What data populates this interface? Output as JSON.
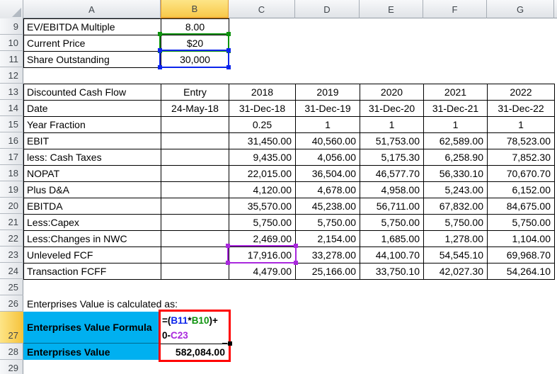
{
  "sheet": {
    "columns": [
      "A",
      "B",
      "C",
      "D",
      "E",
      "F",
      "G"
    ],
    "rows": [
      "9",
      "10",
      "11",
      "12",
      "13",
      "14",
      "15",
      "16",
      "17",
      "18",
      "19",
      "20",
      "21",
      "22",
      "23",
      "24",
      "25",
      "26",
      "27",
      "28",
      "29"
    ],
    "selected_column": "B",
    "selected_row": "27",
    "colors": {
      "cyan_fill": "#00B0F0",
      "highlight_red": "#FF0000",
      "ref_blue": "#0B24EB",
      "ref_green": "#0E930E",
      "ref_purple": "#A928DD",
      "header_selected_border": "#E19A2F"
    }
  },
  "top_table": {
    "rows": [
      {
        "label": "EV/EBITDA Multiple",
        "value": "8.00"
      },
      {
        "label": "Current Price",
        "value": "$20",
        "reference_outline": "green"
      },
      {
        "label": "Share Outstanding",
        "value": "30,000",
        "reference_outline": "blue"
      }
    ]
  },
  "dcf_table": {
    "rows": [
      {
        "label": "Discounted Cash Flow",
        "entry": "Entry",
        "values": [
          "2018",
          "2019",
          "2020",
          "2021",
          "2022"
        ],
        "align": "center"
      },
      {
        "label": "Date",
        "entry": "24-May-18",
        "values": [
          "31-Dec-18",
          "31-Dec-19",
          "31-Dec-20",
          "31-Dec-21",
          "31-Dec-22"
        ],
        "align": "center"
      },
      {
        "label": "Year Fraction",
        "entry": "",
        "values": [
          "0.25",
          "1",
          "1",
          "1",
          "1"
        ],
        "align": "center"
      },
      {
        "label": "EBIT",
        "entry": "",
        "values": [
          "31,450.00",
          "40,560.00",
          "51,753.00",
          "62,589.00",
          "78,523.00"
        ],
        "align": "right"
      },
      {
        "label": "less: Cash Taxes",
        "entry": "",
        "values": [
          "9,435.00",
          "4,056.00",
          "5,175.30",
          "6,258.90",
          "7,852.30"
        ],
        "align": "right"
      },
      {
        "label": "NOPAT",
        "entry": "",
        "values": [
          "22,015.00",
          "36,504.00",
          "46,577.70",
          "56,330.10",
          "70,670.70"
        ],
        "align": "right"
      },
      {
        "label": "Plus D&A",
        "entry": "",
        "values": [
          "4,120.00",
          "4,678.00",
          "4,958.00",
          "5,243.00",
          "6,152.00"
        ],
        "align": "right"
      },
      {
        "label": "EBITDA",
        "entry": "",
        "values": [
          "35,570.00",
          "45,238.00",
          "56,711.00",
          "67,832.00",
          "84,675.00"
        ],
        "align": "right"
      },
      {
        "label": "Less:Capex",
        "entry": "",
        "values": [
          "5,750.00",
          "5,750.00",
          "5,750.00",
          "5,750.00",
          "5,750.00"
        ],
        "align": "right"
      },
      {
        "label": "Less:Changes in NWC",
        "entry": "",
        "values": [
          "2,469.00",
          "2,154.00",
          "1,685.00",
          "1,278.00",
          "1,104.00"
        ],
        "align": "right"
      },
      {
        "label": "Unleveled FCF",
        "entry": "",
        "values": [
          "17,916.00",
          "33,278.00",
          "44,100.70",
          "54,545.10",
          "69,968.70"
        ],
        "align": "right"
      },
      {
        "label": "Transaction FCFF",
        "entry": "",
        "values": [
          "4,479.00",
          "25,166.00",
          "33,750.10",
          "42,027.30",
          "54,264.10"
        ],
        "align": "right"
      }
    ]
  },
  "footer": {
    "caption": "Enterprises Value is calculated as:",
    "formula_label": "Enterprises Value Formula",
    "value_label": "Enterprises Value",
    "formula": {
      "p1": "=(",
      "p2": "B11",
      "p3": "*",
      "p4": "B10",
      "p5": ")+",
      "p6": "0-",
      "p7": "C23"
    },
    "result": "582,084.00"
  }
}
